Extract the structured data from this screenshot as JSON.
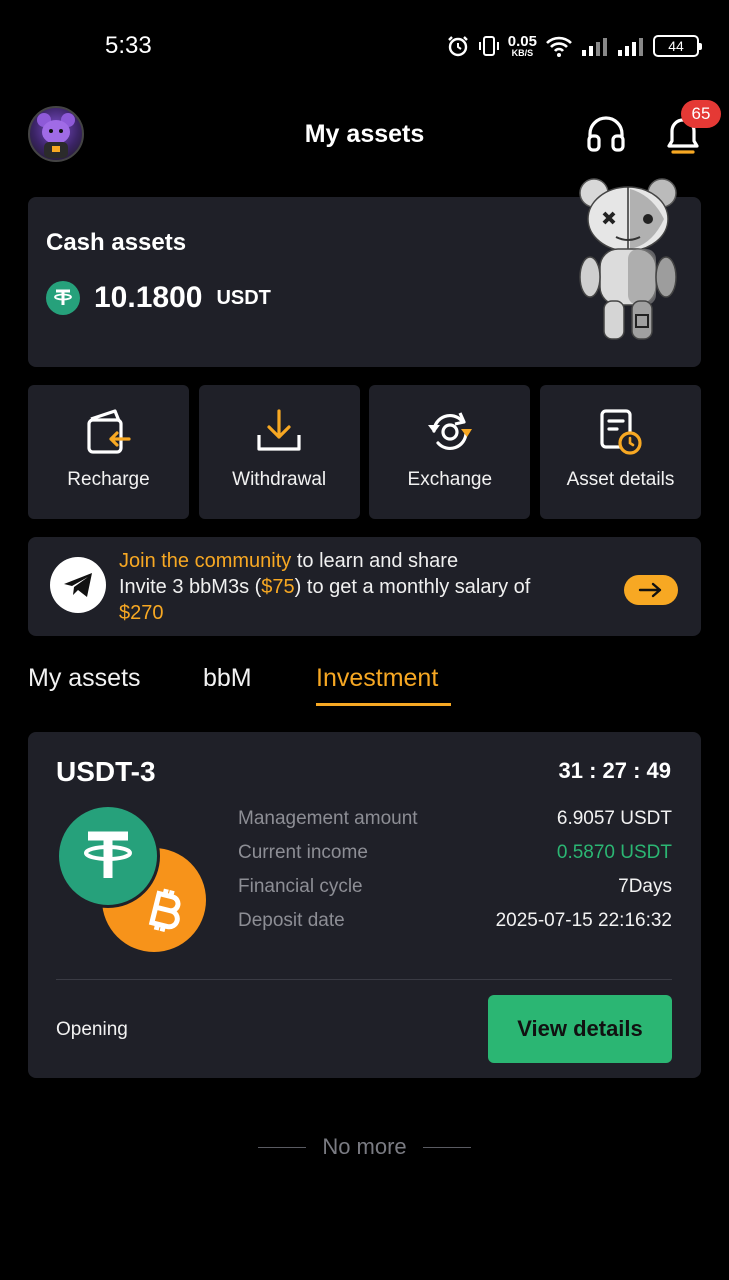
{
  "status_bar": {
    "time": "5:33",
    "net_speed": "0.05",
    "net_unit": "KB/S",
    "battery": "44"
  },
  "header": {
    "title": "My assets",
    "notification_count": "65"
  },
  "cash": {
    "title": "Cash assets",
    "amount": "10.1800",
    "unit": "USDT"
  },
  "actions": [
    {
      "label": "Recharge",
      "icon": "wallet-in-icon"
    },
    {
      "label": "Withdrawal",
      "icon": "download-tray-icon"
    },
    {
      "label": "Exchange",
      "icon": "exchange-cycle-icon"
    },
    {
      "label": "Asset details",
      "icon": "document-clock-icon"
    }
  ],
  "banner": {
    "link_text": "Join the community",
    "text1": " to learn and share",
    "text2": "Invite 3 bbM3s (",
    "amount1": "$75",
    "text3": ") to get a monthly salary of",
    "amount2": "$270"
  },
  "tabs": [
    {
      "label": "My assets",
      "active": false
    },
    {
      "label": "bbM",
      "active": false
    },
    {
      "label": "Investment",
      "active": true
    }
  ],
  "investment": {
    "name": "USDT-3",
    "timer": "31 : 27 : 49",
    "rows": [
      {
        "key": "Management amount",
        "value": "6.9057 USDT"
      },
      {
        "key": "Current income",
        "value": "0.5870 USDT"
      },
      {
        "key": "Financial cycle",
        "value": "7Days"
      },
      {
        "key": "Deposit date",
        "value": "2025-07-15 22:16:32"
      }
    ],
    "status": "Opening",
    "button": "View details"
  },
  "footer": {
    "no_more": "No more"
  },
  "colors": {
    "accent": "#f7a823",
    "success": "#2bb673",
    "card": "#1f2028",
    "badge": "#e53935"
  }
}
